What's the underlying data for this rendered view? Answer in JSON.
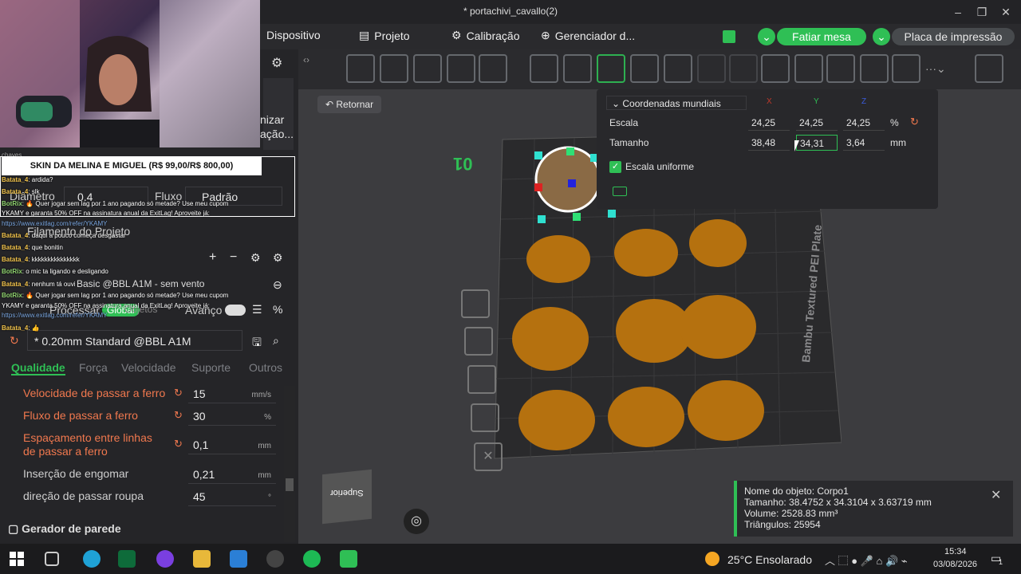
{
  "window": {
    "title": "* portachivi_cavallo(2)"
  },
  "menubar": {
    "items": [
      {
        "label": "Dispositivo"
      },
      {
        "label": "Projeto"
      },
      {
        "label": "Calibração"
      },
      {
        "label": "Gerenciador d..."
      }
    ],
    "slice_label": "Fatiar mesa",
    "print_label": "Placa de impressão"
  },
  "left": {
    "side_label_1": "nizar",
    "side_label_2": "ação...",
    "diameter_label": "Diâmetro",
    "diameter_value": "0.4",
    "flow_label": "Fluxo",
    "flow_value": "Padrão",
    "filament_label": "Filamento do Projeto",
    "printer_label": "Basic @BBL A1M - sem vento",
    "process_label": "Processar",
    "global_label": "Global",
    "objects_label": "Objetos",
    "advanced_label": "Avanço",
    "preset": "* 0.20mm Standard @BBL A1M",
    "tabs": [
      "Qualidade",
      "Força",
      "Velocidade",
      "Suporte",
      "Outros"
    ],
    "rows": [
      {
        "label": "Velocidade de passar a ferro",
        "value": "15",
        "unit": "mm/s"
      },
      {
        "label": "Fluxo de passar a ferro",
        "value": "30",
        "unit": "%"
      },
      {
        "label": "Espaçamento entre linhas de passar a ferro",
        "value": "0,1",
        "unit": "mm"
      },
      {
        "label": "Inserção de engomar",
        "value": "0,21",
        "unit": "mm"
      },
      {
        "label": "direção de passar roupa",
        "value": "45",
        "unit": "°"
      }
    ],
    "wall_label": "Gerador de parede"
  },
  "chat": {
    "banner": "SKIN DA MELINA E MIGUEL (R$ 99,00/R$ 800,00)",
    "lines": [
      {
        "user": "Batata_4",
        "text": ": ardida?"
      },
      {
        "user": "Batata_4",
        "text": ": slk"
      },
      {
        "user": "BotRix",
        "text": ": 🔥 Quer jogar sem lag por 1 ano pagando só metade? Use meu cupom"
      },
      {
        "user": "",
        "text": "YKAMY e garanta 50% OFF na assinatura anual da ExitLag! Aproveite já:"
      },
      {
        "user": "",
        "text": "https://www.exitlag.com/refer/YKAMY"
      },
      {
        "user": "Batata_4",
        "text": ": daqui a pouco começa desgastar"
      },
      {
        "user": "Batata_4",
        "text": ": que bonitin"
      },
      {
        "user": "Batata_4",
        "text": ": kkkkkkkkkkkkkkk"
      },
      {
        "user": "BotRix",
        "text": ": o mic ta ligando e desligando"
      },
      {
        "user": "Batata_4",
        "text": ": nenhum tá ouvi"
      },
      {
        "user": "BotRix",
        "text": ": 🔥 Quer jogar sem lag por 1 ano pagando só metade? Use meu cupom"
      },
      {
        "user": "",
        "text": "YKAMY e garanta 50% OFF na assinatura anual da ExitLag! Aproveite já:"
      },
      {
        "user": "",
        "text": "https://www.exitlag.com/refer/YKAMY"
      },
      {
        "user": "Batata_4",
        "text": ": 👍"
      }
    ],
    "top_partial": "chaves"
  },
  "viewport": {
    "back_label": "Retornar",
    "plate_label": "Bambu Textured PEI Plate",
    "plate_number": "01",
    "view_cube": "Superior"
  },
  "coords": {
    "dropdown": "Coordenadas mundiais",
    "axes": [
      "X",
      "Y",
      "Z"
    ],
    "scale_label": "Escala",
    "scale_values": [
      "24,25",
      "24,25",
      "24,25"
    ],
    "scale_unit": "%",
    "size_label": "Tamanho",
    "size_values": [
      "38,48",
      "34,31",
      "3,64"
    ],
    "size_unit": "mm",
    "uniform_label": "Escala uniforme"
  },
  "info": {
    "name": "Nome do objeto: Corpo1",
    "size": "Tamanho: 38.4752 x 34.3104 x 3.63719 mm",
    "volume": "Volume: 2528.83 mm³",
    "triangles": "Triângulos: 25954"
  },
  "taskbar": {
    "weather": "25°C  Ensolarado",
    "time": "15:34",
    "date": "03/08/2026",
    "notif_count": "1"
  },
  "colors": {
    "accent": "#2fbf55",
    "warning": "#f0784e",
    "part": "#b5710f"
  }
}
